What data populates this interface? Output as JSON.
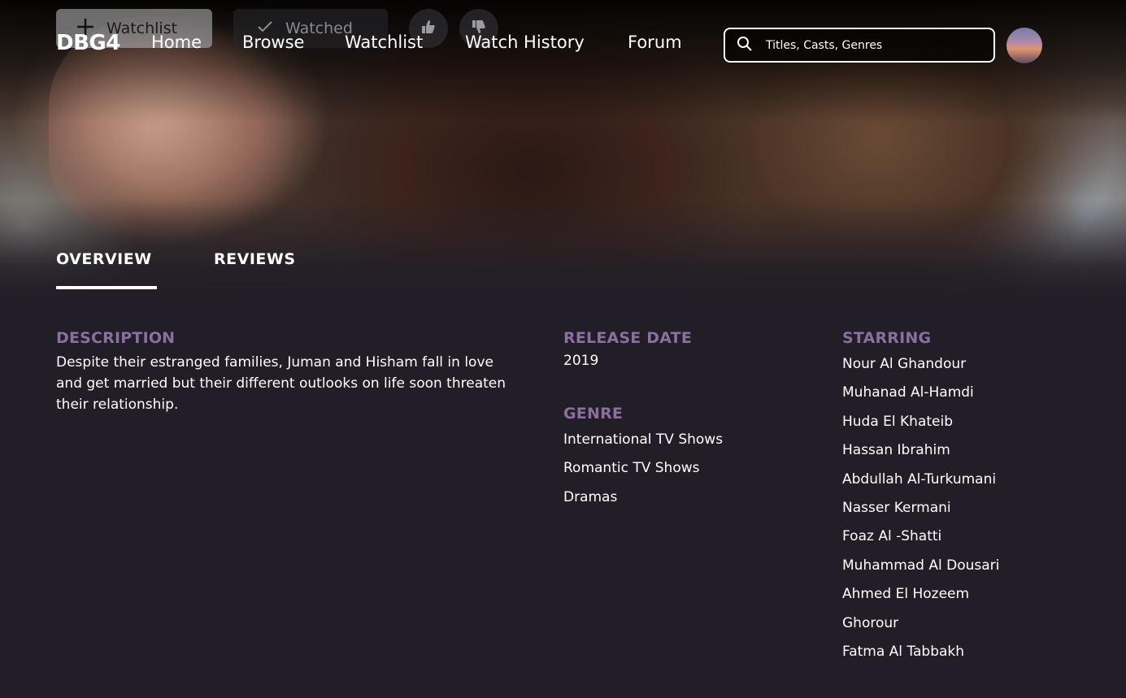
{
  "actions": {
    "watchlist_label": "Watchlist",
    "watched_label": "Watched"
  },
  "header": {
    "logo": "DBG4",
    "nav": [
      "Home",
      "Browse",
      "Watchlist",
      "Watch History",
      "Forum"
    ],
    "search_placeholder": "Titles, Casts, Genres"
  },
  "tabs": [
    "OVERVIEW",
    "REVIEWS"
  ],
  "active_tab": "OVERVIEW",
  "details": {
    "description_label": "DESCRIPTION",
    "description": "Despite their estranged families, Juman and Hisham fall in love and get married but their different outlooks on life soon threaten their relationship.",
    "release_label": "RELEASE DATE",
    "release_date": "2019",
    "genre_label": "GENRE",
    "genres": [
      "International TV Shows",
      "Romantic TV Shows",
      "Dramas"
    ],
    "starring_label": "STARRING",
    "starring": [
      "Nour Al Ghandour",
      "Muhanad Al-Hamdi",
      "Huda El Khateib",
      "Hassan Ibrahim",
      "Abdullah Al-Turkumani",
      "Nasser Kermani",
      "Foaz Al -Shatti",
      "Muhammad Al Dousari",
      "Ahmed El Hozeem",
      "Ghorour",
      "Fatma Al Tabbakh"
    ]
  },
  "colors": {
    "background": "#211e27",
    "section_label": "#8a6fa0",
    "text": "#ffffff"
  }
}
